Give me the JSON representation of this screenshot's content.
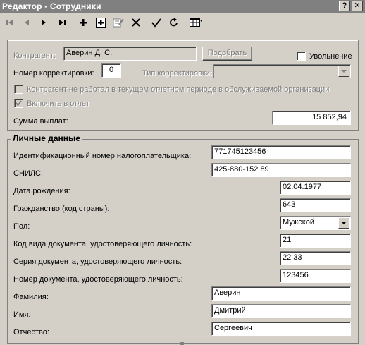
{
  "window": {
    "title": "Редактор - Сотрудники",
    "help_label": "?",
    "close_label": "✕"
  },
  "toolbar": {
    "icons": [
      "first-record-icon",
      "prev-record-icon",
      "next-record-icon",
      "last-record-icon",
      "add-icon",
      "add-copy-icon",
      "edit-icon",
      "delete-icon",
      "confirm-icon",
      "refresh-icon",
      "table-view-icon"
    ]
  },
  "header": {
    "contractor_label": "Контрагент:",
    "contractor_value": "Аверин Д. С.",
    "select_button": "Подобрать",
    "dismissal_label": "Увольнение",
    "correction_number_label": "Номер корректировки:",
    "correction_number_value": "0",
    "correction_type_label": "Тип корректировки:",
    "correction_type_value": "",
    "not_worked_label": "Контрагент не работал в текущем отчетном периоде в обслуживаемой организации",
    "include_label": "Включить в отчет",
    "payments_label": "Сумма выплат:",
    "payments_value": "15 852,94"
  },
  "personal": {
    "section_title": "Личные данные",
    "inn_label": "Идентификационный номер налогоплательщика:",
    "inn_value": "771745123456",
    "snils_label": "СНИЛС:",
    "snils_value": "425-880-152 89",
    "birth_label": "Дата рождения:",
    "birth_value": "02.04.1977",
    "citizenship_label": "Гражданство (код страны):",
    "citizenship_value": "643",
    "gender_label": "Пол:",
    "gender_value": "Мужской",
    "doc_code_label": "Код вида документа, удостоверяющего личность:",
    "doc_code_value": "21",
    "doc_series_label": "Серия документа, удостоверяющего личность:",
    "doc_series_value": "22 33",
    "doc_number_label": "Номер документа, удостоверяющего личность:",
    "doc_number_value": "123456",
    "surname_label": "Фамилия:",
    "surname_value": "Аверин",
    "name_label": "Имя:",
    "name_value": "Дмитрий",
    "patronymic_label": "Отчество:",
    "patronymic_value": "Сергеевич"
  }
}
